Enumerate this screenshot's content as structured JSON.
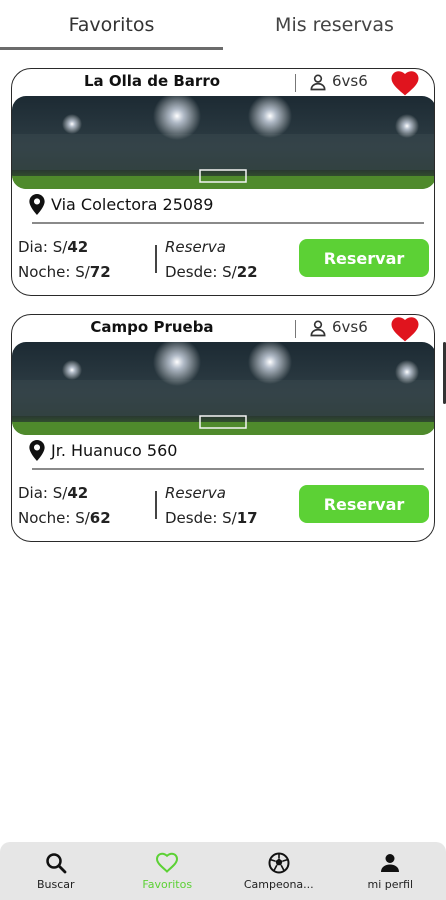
{
  "tabs": [
    {
      "label": "Favoritos",
      "active": true
    },
    {
      "label": "Mis reservas",
      "active": false
    }
  ],
  "cards": [
    {
      "name": "La Olla de Barro",
      "players": "6vs6",
      "address": "Via Colectora 25089",
      "day_label": "Dia: S/",
      "day_price": "42",
      "night_label": "Noche: S/",
      "night_price": "72",
      "reserve_label": "Reserva",
      "from_label": "Desde: S/",
      "from_price": "22",
      "button": "Reservar"
    },
    {
      "name": "Campo Prueba",
      "players": "6vs6",
      "address": "Jr. Huanuco 560",
      "day_label": "Dia: S/",
      "day_price": "42",
      "night_label": "Noche: S/",
      "night_price": "62",
      "reserve_label": "Reserva",
      "from_label": "Desde: S/",
      "from_price": "17",
      "button": "Reservar"
    }
  ],
  "nav": [
    {
      "label": "Buscar",
      "icon": "search-icon",
      "active": false
    },
    {
      "label": "Favoritos",
      "icon": "heart-outline-icon",
      "active": true
    },
    {
      "label": "Campeona...",
      "icon": "soccer-ball-icon",
      "active": false
    },
    {
      "label": "mi perfil",
      "icon": "person-icon",
      "active": false
    }
  ],
  "colors": {
    "accent": "#5cd135",
    "heart": "#e0141e",
    "nav_bg": "#e6e6e6"
  }
}
